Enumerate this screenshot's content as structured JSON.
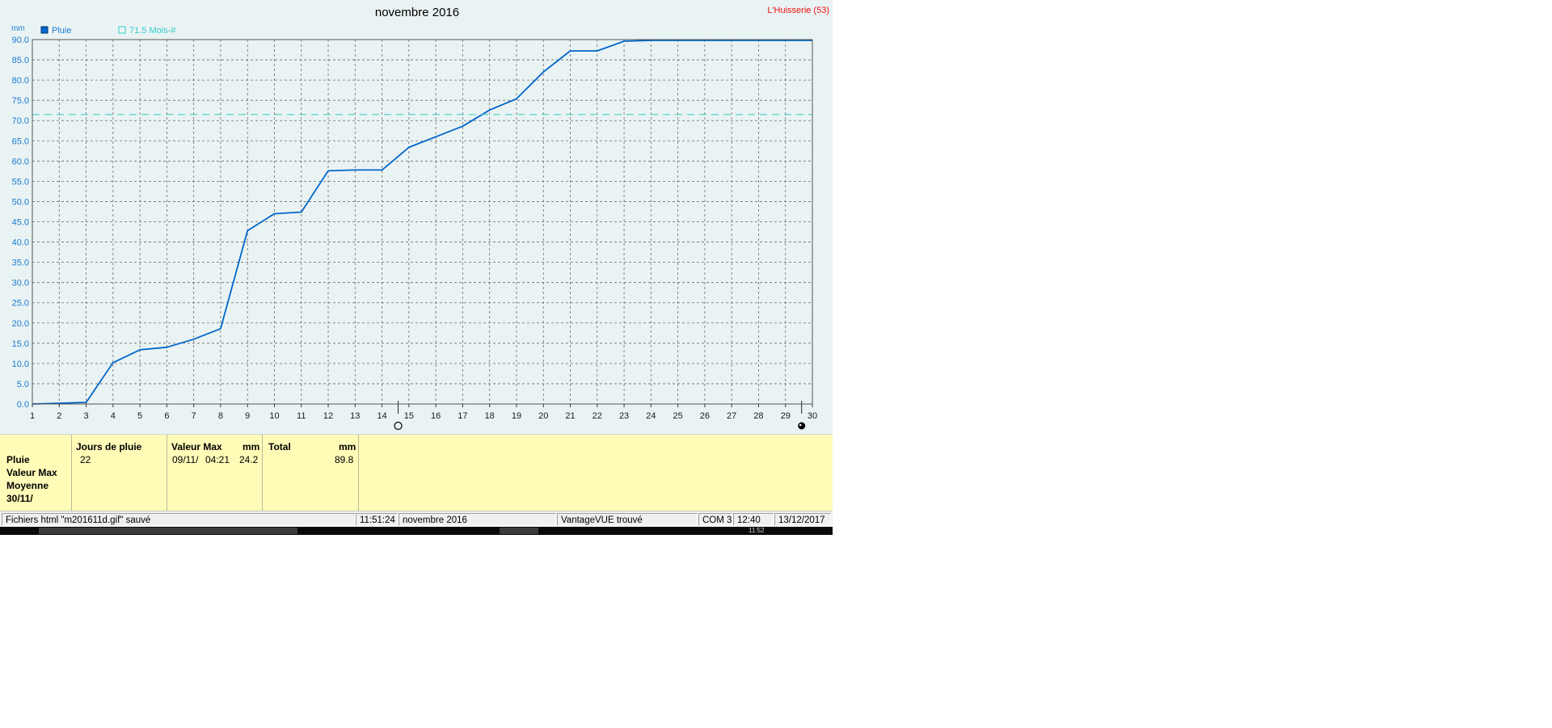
{
  "chart": {
    "title": "novembre 2016",
    "station": "L'Huisserie (53)",
    "ylabel": "mm",
    "legend": [
      {
        "label": "Pluie",
        "color": "#0066cc",
        "marker": "filled-square"
      },
      {
        "label": "71.5 Mois-#",
        "color": "#33cccc",
        "marker": "open-square"
      }
    ],
    "markers": {
      "new_moon_icon": "moon-new-icon",
      "full_moon_icon": "moon-full-icon"
    }
  },
  "chart_data": {
    "type": "line",
    "title": "novembre 2016",
    "xlabel": "",
    "ylabel": "mm",
    "xlim": [
      1,
      30
    ],
    "ylim": [
      0,
      90
    ],
    "grid": true,
    "legend_position": "top-left",
    "x": [
      1,
      2,
      3,
      4,
      5,
      6,
      7,
      8,
      9,
      10,
      11,
      12,
      13,
      14,
      15,
      16,
      17,
      18,
      19,
      20,
      21,
      22,
      23,
      24,
      25,
      26,
      27,
      28,
      29,
      30
    ],
    "x_tick_labels": [
      "1",
      "2",
      "3",
      "4",
      "5",
      "6",
      "7",
      "8",
      "9",
      "10",
      "11",
      "12",
      "13",
      "14",
      "15",
      "16",
      "17",
      "18",
      "19",
      "20",
      "21",
      "22",
      "23",
      "24",
      "25",
      "26",
      "27",
      "28",
      "29",
      "30"
    ],
    "y_tick_labels": [
      "0.0",
      "5.0",
      "10.0",
      "15.0",
      "20.0",
      "25.0",
      "30.0",
      "35.0",
      "40.0",
      "45.0",
      "50.0",
      "55.0",
      "60.0",
      "65.0",
      "70.0",
      "75.0",
      "80.0",
      "85.0",
      "90.0"
    ],
    "y_ticks": [
      0,
      5,
      10,
      15,
      20,
      25,
      30,
      35,
      40,
      45,
      50,
      55,
      60,
      65,
      70,
      75,
      80,
      85,
      90
    ],
    "series": [
      {
        "name": "Pluie",
        "color": "#0066cc",
        "values": [
          0.0,
          0.2,
          0.4,
          10.2,
          13.4,
          14.0,
          16.0,
          18.6,
          42.8,
          47.0,
          47.4,
          57.6,
          57.8,
          57.8,
          63.4,
          66.0,
          68.6,
          72.6,
          75.4,
          82.0,
          87.2,
          87.2,
          89.6,
          89.8,
          89.8,
          89.8,
          89.8,
          89.8,
          89.8,
          89.8
        ]
      },
      {
        "name": "71.5 Mois-#",
        "color": "#33cccc",
        "style": "dashed",
        "values": [
          71.5,
          71.5,
          71.5,
          71.5,
          71.5,
          71.5,
          71.5,
          71.5,
          71.5,
          71.5,
          71.5,
          71.5,
          71.5,
          71.5,
          71.5,
          71.5,
          71.5,
          71.5,
          71.5,
          71.5,
          71.5,
          71.5,
          71.5,
          71.5,
          71.5,
          71.5,
          71.5,
          71.5,
          71.5,
          71.5
        ]
      }
    ],
    "annotations": [
      {
        "x": 14.6,
        "icon": "new-moon"
      },
      {
        "x": 29.6,
        "icon": "full-moon"
      }
    ]
  },
  "stats": {
    "row_labels": [
      "Pluie",
      "Valeur Max",
      "Moyenne",
      "30/11/"
    ],
    "jours_header": "Jours de pluie",
    "jours_value": "22",
    "max_header": "Valeur Max",
    "max_unit": "mm",
    "max_date": "09/11/",
    "max_time": "04:21",
    "max_value": "24.2",
    "total_header": "Total",
    "total_unit": "mm",
    "total_value": "89.8"
  },
  "status_bar": {
    "message": "Fichiers html  \"m201611d.gif\"  sauvé",
    "time": "11:51:24",
    "period": "novembre 2016",
    "device": "VantageVUE trouvé",
    "port": "COM 3",
    "clock": "12:40",
    "date": "13/12/2017"
  },
  "taskbar": {
    "clock": "11:52"
  }
}
